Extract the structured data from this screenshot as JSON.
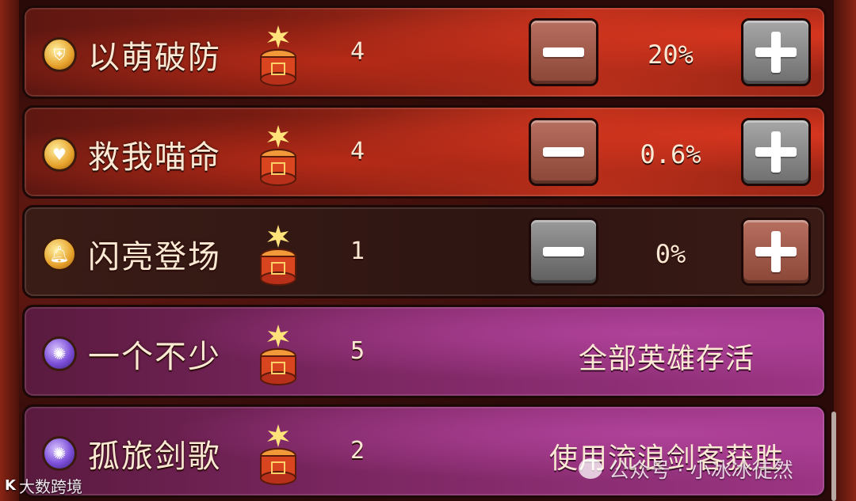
{
  "rows": [
    {
      "id": "yimengpofang",
      "name": "以萌破防",
      "icon": "shield-break-icon",
      "firecracker_count": "4",
      "percent": "20%",
      "theme": "red",
      "minus_style": "rust",
      "plus_style": "grey"
    },
    {
      "id": "jiuwomiaoming",
      "name": "救我喵命",
      "icon": "heart-heal-icon",
      "firecracker_count": "4",
      "percent": "0.6%",
      "theme": "red",
      "minus_style": "rust",
      "plus_style": "grey"
    },
    {
      "id": "shanliangdengchang",
      "name": "闪亮登场",
      "icon": "bell-icon",
      "firecracker_count": "1",
      "percent": "0%",
      "theme": "dark",
      "minus_style": "grey",
      "plus_style": "rust"
    },
    {
      "id": "yigebushao",
      "name": "一个不少",
      "icon": "vortex-icon",
      "firecracker_count": "5",
      "condition": "全部英雄存活",
      "theme": "purple"
    },
    {
      "id": "gulvjiange",
      "name": "孤旅剑歌",
      "icon": "vortex-icon",
      "firecracker_count": "2",
      "condition": "使用流浪剑客获胜",
      "theme": "purple"
    }
  ],
  "watermarks": {
    "left_logo": "K",
    "left_text": "大数跨境",
    "right_text": "公众号 · 小冰冰徒然"
  },
  "colors": {
    "row_red": "#b8301b",
    "row_dark": "#2e1512",
    "row_purple": "#7a2660",
    "text": "#fbe9d4"
  }
}
